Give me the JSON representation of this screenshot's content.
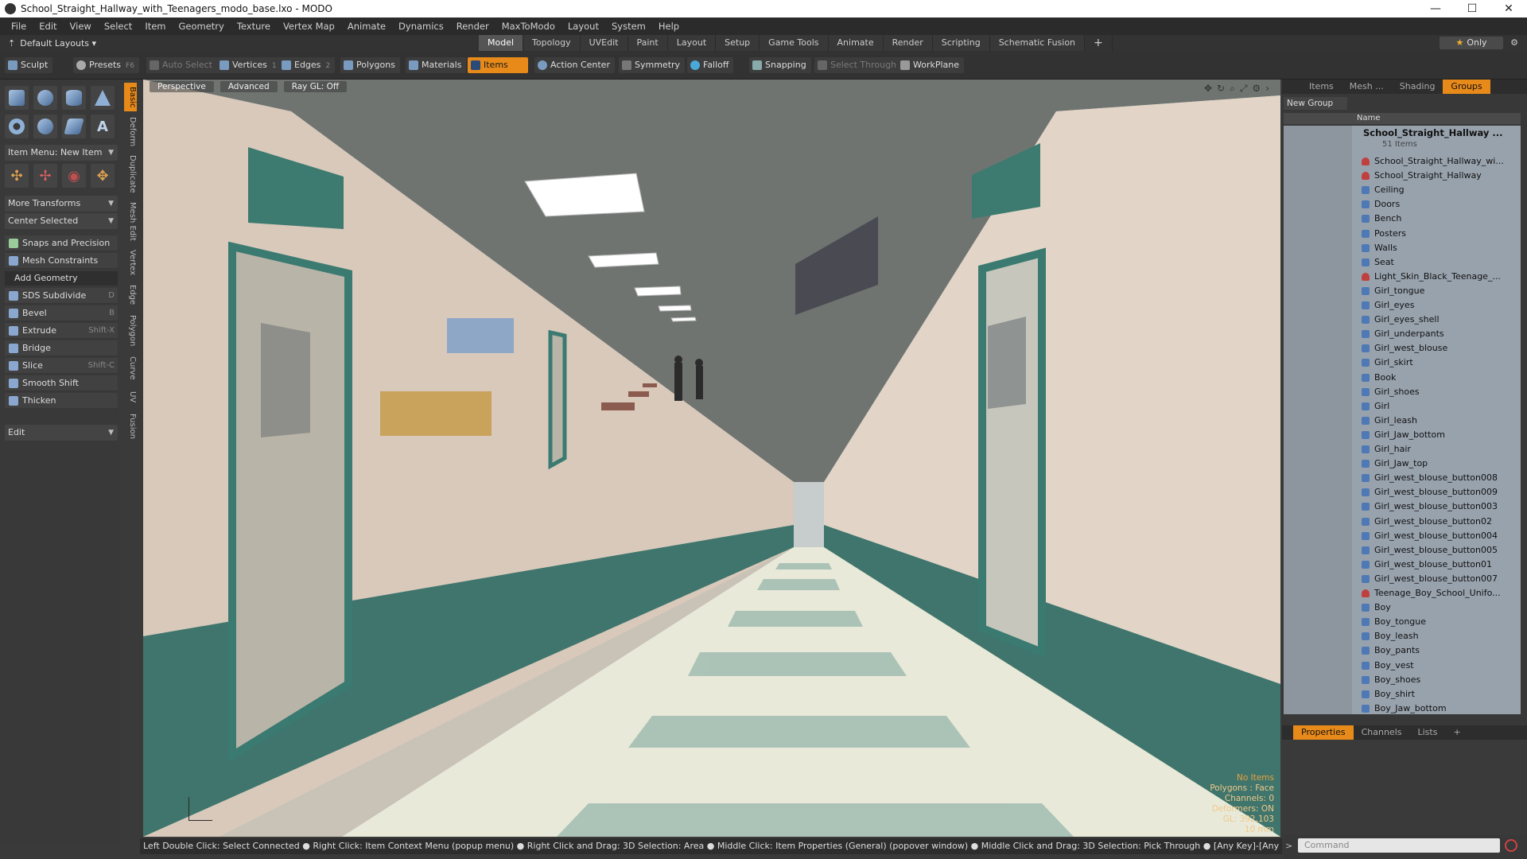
{
  "window": {
    "title": "School_Straight_Hallway_with_Teenagers_modo_base.lxo - MODO",
    "controls": [
      "—",
      "☐",
      "✕"
    ]
  },
  "menu": [
    "File",
    "Edit",
    "View",
    "Select",
    "Item",
    "Geometry",
    "Texture",
    "Vertex Map",
    "Animate",
    "Dynamics",
    "Render",
    "MaxToModo",
    "Layout",
    "System",
    "Help"
  ],
  "layout": {
    "default_layouts": "Default Layouts ▾",
    "tabs": [
      "Model",
      "Topology",
      "UVEdit",
      "Paint",
      "Layout",
      "Setup",
      "Game Tools",
      "Animate",
      "Render",
      "Scripting",
      "Schematic Fusion"
    ],
    "active_tab": "Model",
    "only_label": "Only",
    "plus": "+"
  },
  "toolbar": {
    "sculpt": "Sculpt",
    "presets": "Presets",
    "presets_key": "F6",
    "auto_select": "Auto Select",
    "vertices": "Vertices",
    "vertices_num": "1",
    "edges": "Edges",
    "edges_num": "2",
    "polygons": "Polygons",
    "materials": "Materials",
    "items": "Items",
    "action_center": "Action Center",
    "symmetry": "Symmetry",
    "falloff": "Falloff",
    "snapping": "Snapping",
    "select_through": "Select Through",
    "workplane": "WorkPlane"
  },
  "leftpanel": {
    "item_menu": "Item Menu: New Item",
    "more_transforms": "More Transforms",
    "center_selected": "Center Selected",
    "snaps": "Snaps and Precision",
    "mesh_constraints": "Mesh Constraints",
    "add_geometry": "Add Geometry",
    "tools": [
      {
        "label": "SDS Subdivide",
        "key": "D"
      },
      {
        "label": "Bevel",
        "key": "B"
      },
      {
        "label": "Extrude",
        "key": "Shift-X"
      },
      {
        "label": "Bridge",
        "key": ""
      },
      {
        "label": "Slice",
        "key": "Shift-C"
      },
      {
        "label": "Smooth Shift",
        "key": ""
      },
      {
        "label": "Thicken",
        "key": ""
      }
    ],
    "edit": "Edit"
  },
  "sidetabs": [
    "Basic",
    "Deform",
    "Duplicate",
    "Mesh Edit",
    "Vertex",
    "Edge",
    "Polygon",
    "Curve",
    "UV",
    "Fusion"
  ],
  "viewport": {
    "view": "Perspective",
    "advanced": "Advanced",
    "raygl": "Ray GL: Off",
    "info": [
      "No Items",
      "Polygons : Face",
      "Channels: 0",
      "Deformers: ON",
      "GL: 392,103",
      "10 mm"
    ]
  },
  "status": "Left Double Click: Select Connected ● Right Click: Item Context Menu (popup menu) ● Right Click and Drag: 3D Selection: Area ● Middle Click: Item Properties (General) (popover window) ● Middle Click and Drag: 3D Selection: Pick Through ● [Any Key]-[Any Button] Click and Drag: dragDrop...",
  "rightpanel": {
    "tabs": [
      "Items",
      "Mesh ...",
      "Shading",
      "Groups"
    ],
    "active_tab": "Groups",
    "new_group": "New Group",
    "col_name": "Name",
    "root": "School_Straight_Hallway ...",
    "root_count": "51 Items",
    "items": [
      {
        "label": "School_Straight_Hallway_wi...",
        "type": "person"
      },
      {
        "label": "School_Straight_Hallway",
        "type": "person"
      },
      {
        "label": "Ceiling",
        "type": "mesh"
      },
      {
        "label": "Doors",
        "type": "mesh"
      },
      {
        "label": "Bench",
        "type": "mesh"
      },
      {
        "label": "Posters",
        "type": "mesh"
      },
      {
        "label": "Walls",
        "type": "mesh"
      },
      {
        "label": "Seat",
        "type": "mesh"
      },
      {
        "label": "Light_Skin_Black_Teenage_...",
        "type": "person"
      },
      {
        "label": "Girl_tongue",
        "type": "mesh"
      },
      {
        "label": "Girl_eyes",
        "type": "mesh"
      },
      {
        "label": "Girl_eyes_shell",
        "type": "mesh"
      },
      {
        "label": "Girl_underpants",
        "type": "mesh"
      },
      {
        "label": "Girl_west_blouse",
        "type": "mesh"
      },
      {
        "label": "Girl_skirt",
        "type": "mesh"
      },
      {
        "label": "Book",
        "type": "mesh"
      },
      {
        "label": "Girl_shoes",
        "type": "mesh"
      },
      {
        "label": "Girl",
        "type": "mesh"
      },
      {
        "label": "Girl_leash",
        "type": "mesh"
      },
      {
        "label": "Girl_Jaw_bottom",
        "type": "mesh"
      },
      {
        "label": "Girl_hair",
        "type": "mesh"
      },
      {
        "label": "Girl_Jaw_top",
        "type": "mesh"
      },
      {
        "label": "Girl_west_blouse_button008",
        "type": "mesh"
      },
      {
        "label": "Girl_west_blouse_button009",
        "type": "mesh"
      },
      {
        "label": "Girl_west_blouse_button003",
        "type": "mesh"
      },
      {
        "label": "Girl_west_blouse_button02",
        "type": "mesh"
      },
      {
        "label": "Girl_west_blouse_button004",
        "type": "mesh"
      },
      {
        "label": "Girl_west_blouse_button005",
        "type": "mesh"
      },
      {
        "label": "Girl_west_blouse_button01",
        "type": "mesh"
      },
      {
        "label": "Girl_west_blouse_button007",
        "type": "mesh"
      },
      {
        "label": "Teenage_Boy_School_Unifo...",
        "type": "person"
      },
      {
        "label": "Boy",
        "type": "mesh"
      },
      {
        "label": "Boy_tongue",
        "type": "mesh"
      },
      {
        "label": "Boy_leash",
        "type": "mesh"
      },
      {
        "label": "Boy_pants",
        "type": "mesh"
      },
      {
        "label": "Boy_vest",
        "type": "mesh"
      },
      {
        "label": "Boy_shoes",
        "type": "mesh"
      },
      {
        "label": "Boy_shirt",
        "type": "mesh"
      },
      {
        "label": "Boy_Jaw_bottom",
        "type": "mesh"
      }
    ],
    "bottom_tabs": [
      "Properties",
      "Channels",
      "Lists",
      "+"
    ],
    "bottom_active": "Properties",
    "command_placeholder": "Command"
  },
  "colors": {
    "accent": "#e88a1a",
    "panel": "#383838",
    "list_bg": "#98a2ad"
  }
}
